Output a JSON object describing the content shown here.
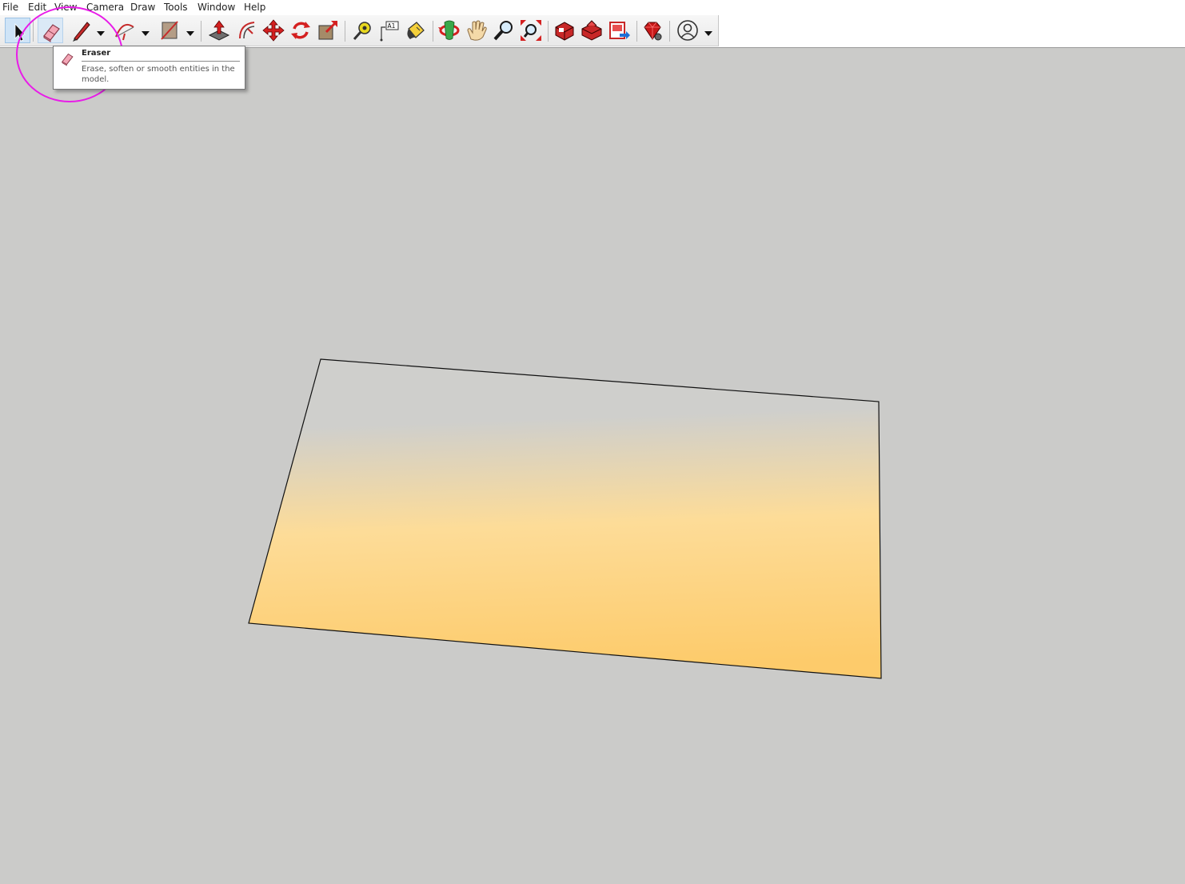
{
  "menu": [
    "File",
    "Edit",
    "View",
    "Camera",
    "Draw",
    "Tools",
    "Window",
    "Help"
  ],
  "toolbar": {
    "tools": [
      {
        "name": "Select",
        "icon": "select-arrow-icon",
        "state": "active"
      },
      {
        "name": "Eraser",
        "icon": "eraser-icon",
        "state": "hover"
      },
      {
        "name": "Line",
        "icon": "pencil-icon",
        "has_dropdown": true
      },
      {
        "name": "Arc",
        "icon": "arc-icon",
        "has_dropdown": true
      },
      {
        "name": "Rectangle",
        "icon": "rectangle-icon",
        "has_dropdown": true
      },
      {
        "name": "Push/Pull",
        "icon": "push-pull-icon"
      },
      {
        "name": "Offset",
        "icon": "offset-icon"
      },
      {
        "name": "Move",
        "icon": "move-icon"
      },
      {
        "name": "Rotate",
        "icon": "rotate-icon"
      },
      {
        "name": "Scale",
        "icon": "scale-icon"
      },
      {
        "name": "Tape Measure",
        "icon": "tape-measure-icon"
      },
      {
        "name": "Text",
        "icon": "text-icon",
        "text": "A1"
      },
      {
        "name": "Paint Bucket",
        "icon": "paint-bucket-icon"
      },
      {
        "name": "Orbit",
        "icon": "orbit-icon"
      },
      {
        "name": "Pan",
        "icon": "pan-hand-icon"
      },
      {
        "name": "Zoom",
        "icon": "zoom-icon"
      },
      {
        "name": "Zoom Extents",
        "icon": "zoom-extents-icon"
      },
      {
        "name": "3D Warehouse",
        "icon": "warehouse-icon"
      },
      {
        "name": "Extension Warehouse",
        "icon": "extension-warehouse-icon"
      },
      {
        "name": "Send to LayOut",
        "icon": "send-to-layout-icon"
      },
      {
        "name": "Extension Manager",
        "icon": "ruby-gem-icon"
      },
      {
        "name": "Account",
        "icon": "user-account-icon",
        "has_dropdown": true
      }
    ]
  },
  "tooltip": {
    "title": "Eraser",
    "description": "Erase, soften or smooth entities in the model.",
    "icon": "eraser-icon"
  },
  "annotation": {
    "color": "#e81ce8",
    "shape": "circle",
    "target": "Eraser"
  },
  "canvas": {
    "background": "#cbcbc9",
    "face_gradient": [
      "#cfcfcc",
      "#fddc98",
      "#fdcb6b"
    ],
    "edge_color": "#111111"
  }
}
